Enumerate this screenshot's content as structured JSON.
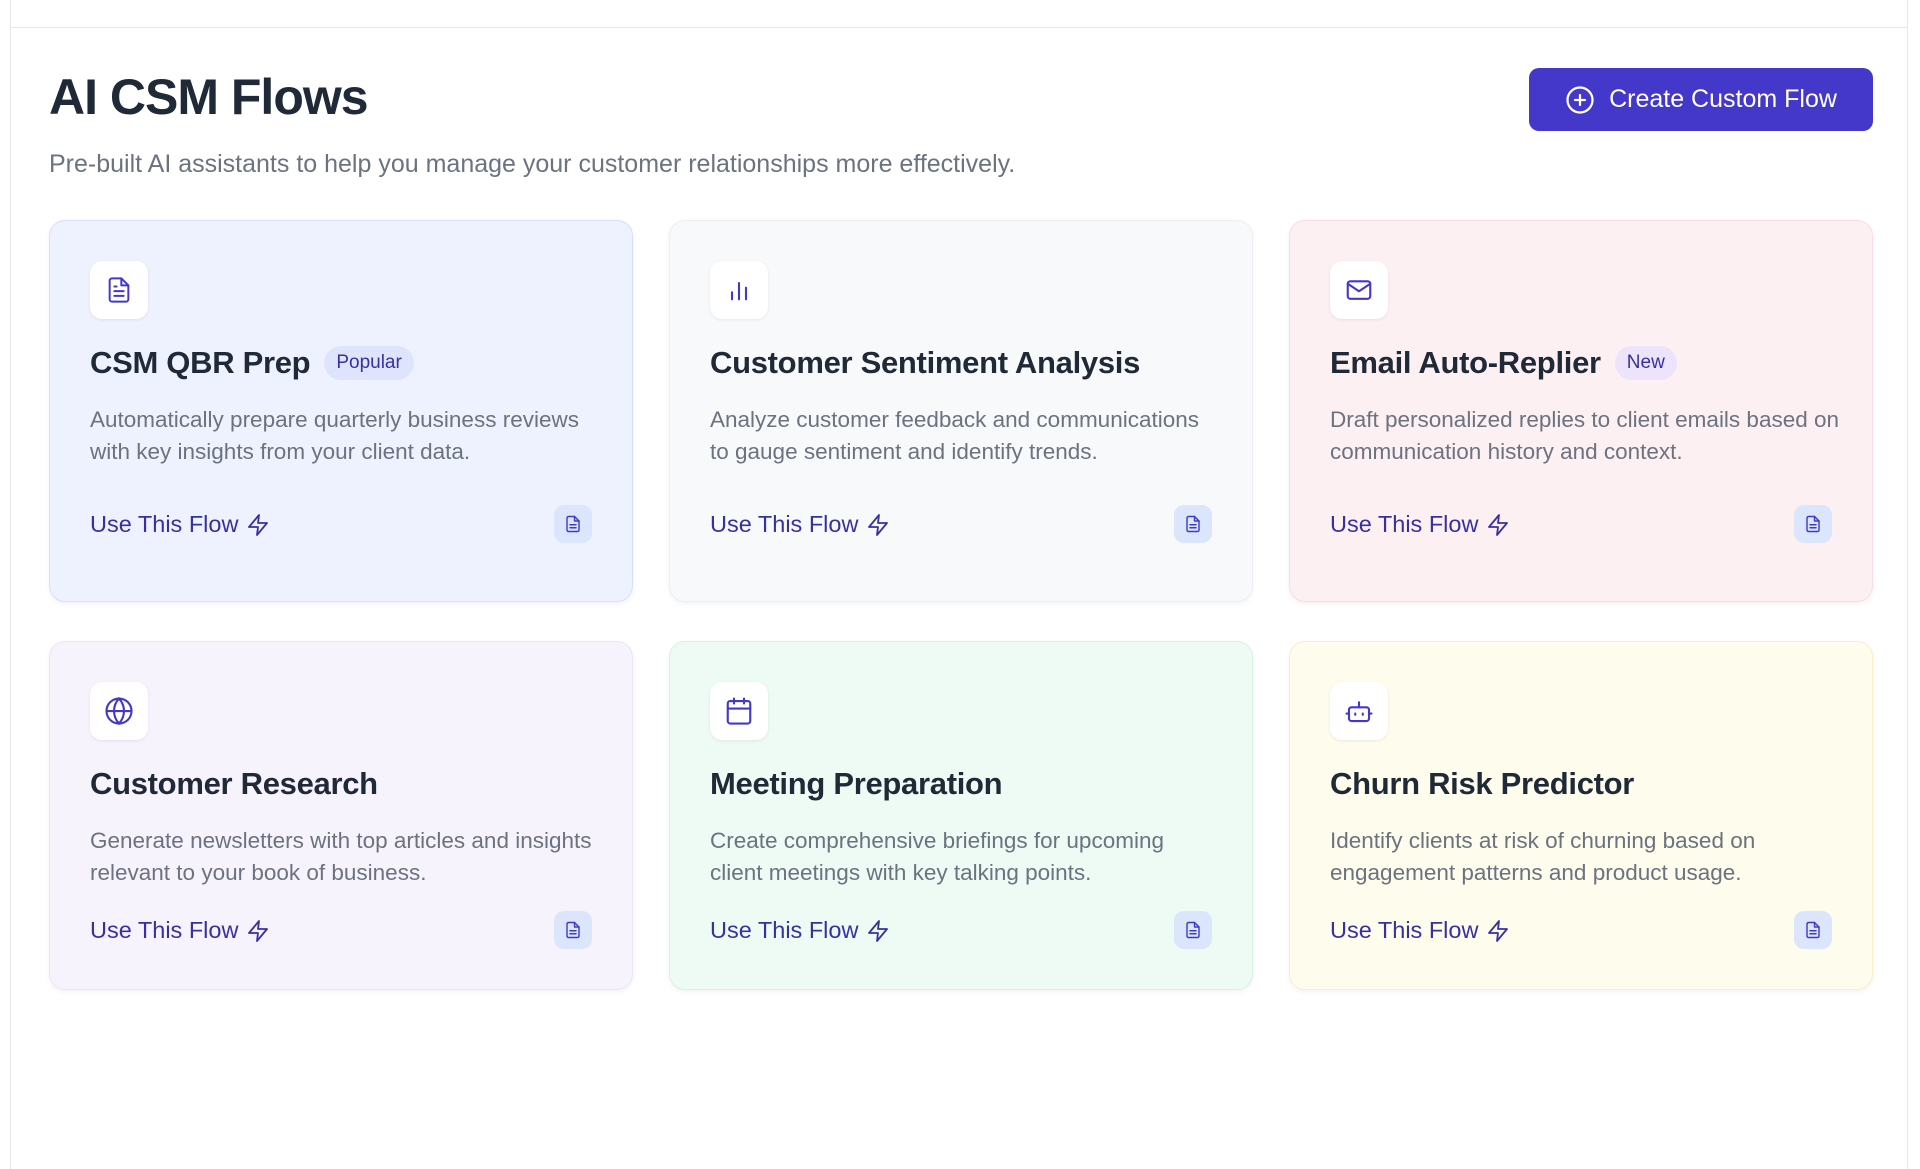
{
  "header": {
    "title": "AI CSM Flows",
    "subtitle": "Pre-built AI assistants to help you manage your customer relationships more effectively.",
    "create_button_label": "Create Custom Flow",
    "accent_color": "#4338ca"
  },
  "cards": [
    {
      "title": "CSM QBR Prep",
      "badge": "Popular",
      "description": "Automatically prepare quarterly business reviews with key insights from your client data.",
      "link_label": "Use This Flow",
      "icon": "document-icon",
      "background": "#eef2fe",
      "border": "#d5e0fb",
      "badge_bg": "#dde4fb"
    },
    {
      "title": "Customer Sentiment Analysis",
      "badge": "",
      "description": "Analyze customer feedback and communications to gauge sentiment and identify trends.",
      "link_label": "Use This Flow",
      "icon": "bar-chart-icon",
      "background": "#f8f9fb",
      "border": "#eceef2"
    },
    {
      "title": "Email Auto-Replier",
      "badge": "New",
      "description": "Draft personalized replies to client emails based on communication history and context.",
      "link_label": "Use This Flow",
      "icon": "mail-icon",
      "background": "#fdf0f3",
      "border": "#f8dde4",
      "badge_bg": "#ede3fb"
    },
    {
      "title": "Customer Research",
      "badge": "",
      "description": "Generate newsletters with top articles and insights relevant to your book of business.",
      "link_label": "Use This Flow",
      "icon": "globe-icon",
      "background": "#f7f3fd",
      "border": "#ece4fa"
    },
    {
      "title": "Meeting Preparation",
      "badge": "",
      "description": "Create comprehensive briefings for upcoming client meetings with key talking points.",
      "link_label": "Use This Flow",
      "icon": "calendar-icon",
      "background": "#edfbf4",
      "border": "#d6f3e3"
    },
    {
      "title": "Churn Risk Predictor",
      "badge": "",
      "description": "Identify clients at risk of churning based on engagement patterns and product usage.",
      "link_label": "Use This Flow",
      "icon": "robot-icon",
      "background": "#fefcec",
      "border": "#f8efcd"
    }
  ]
}
